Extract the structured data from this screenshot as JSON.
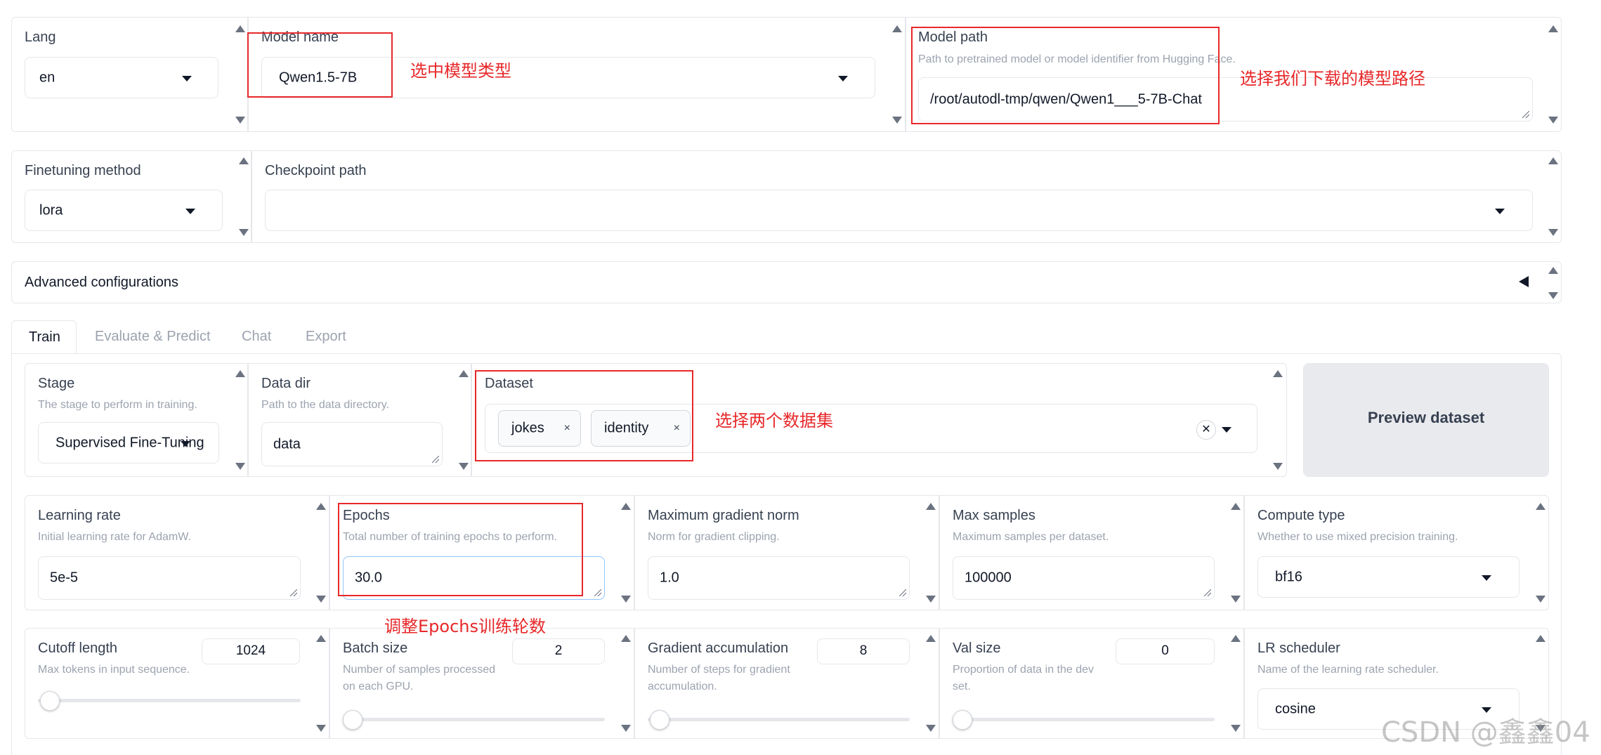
{
  "row1": {
    "lang": {
      "label": "Lang",
      "value": "en"
    },
    "model_name": {
      "label": "Model name",
      "value": "Qwen1.5-7B"
    },
    "model_path": {
      "label": "Model path",
      "info": "Path to pretrained model or model identifier from Hugging Face.",
      "value": "/root/autodl-tmp/qwen/Qwen1___5-7B-Chat"
    }
  },
  "row2": {
    "finetuning_method": {
      "label": "Finetuning method",
      "value": "lora"
    },
    "checkpoint_path": {
      "label": "Checkpoint path",
      "value": ""
    }
  },
  "advanced": {
    "label": "Advanced configurations"
  },
  "tabs": [
    {
      "label": "Train",
      "active": true
    },
    {
      "label": "Evaluate & Predict",
      "active": false
    },
    {
      "label": "Chat",
      "active": false
    },
    {
      "label": "Export",
      "active": false
    }
  ],
  "train": {
    "stage": {
      "label": "Stage",
      "info": "The stage to perform in training.",
      "value": "Supervised Fine-Tuning"
    },
    "data_dir": {
      "label": "Data dir",
      "info": "Path to the data directory.",
      "value": "data"
    },
    "dataset": {
      "label": "Dataset",
      "chips": [
        "jokes",
        "identity"
      ],
      "chip_close": "×",
      "clear": "✕"
    },
    "preview_button": "Preview dataset",
    "learning_rate": {
      "label": "Learning rate",
      "info": "Initial learning rate for AdamW.",
      "value": "5e-5"
    },
    "epochs": {
      "label": "Epochs",
      "info": "Total number of training epochs to perform.",
      "value": "30.0"
    },
    "max_grad_norm": {
      "label": "Maximum gradient norm",
      "info": "Norm for gradient clipping.",
      "value": "1.0"
    },
    "max_samples": {
      "label": "Max samples",
      "info": "Maximum samples per dataset.",
      "value": "100000"
    },
    "compute_type": {
      "label": "Compute type",
      "info": "Whether to use mixed precision training.",
      "value": "bf16"
    },
    "cutoff_length": {
      "label": "Cutoff length",
      "info": "Max tokens in input sequence.",
      "value": "1024",
      "slider_fraction": 0.03
    },
    "batch_size": {
      "label": "Batch size",
      "info_line1": "Number of samples processed",
      "info_line2": "on each GPU.",
      "value": "2",
      "slider_fraction": 0.0
    },
    "grad_accum": {
      "label": "Gradient accumulation",
      "info_line1": "Number of steps for gradient",
      "info_line2": "accumulation.",
      "value": "8",
      "slider_fraction": 0.03
    },
    "val_size": {
      "label": "Val size",
      "info_line1": "Proportion of data in the dev",
      "info_line2": "set.",
      "value": "0",
      "slider_fraction": 0.0
    },
    "lr_scheduler": {
      "label": "LR scheduler",
      "info": "Name of the learning rate scheduler.",
      "value": "cosine"
    }
  },
  "annotations": {
    "model_type": "选中模型类型",
    "model_path": "选择我们下载的模型路径",
    "datasets": "选择两个数据集",
    "epochs": "调整Epochs训练轮数"
  },
  "watermark": "CSDN @鑫鑫04",
  "colors": {
    "annotation_red": "#e8282a",
    "border": "#e5e7eb",
    "focus_blue": "#93c5fd"
  }
}
